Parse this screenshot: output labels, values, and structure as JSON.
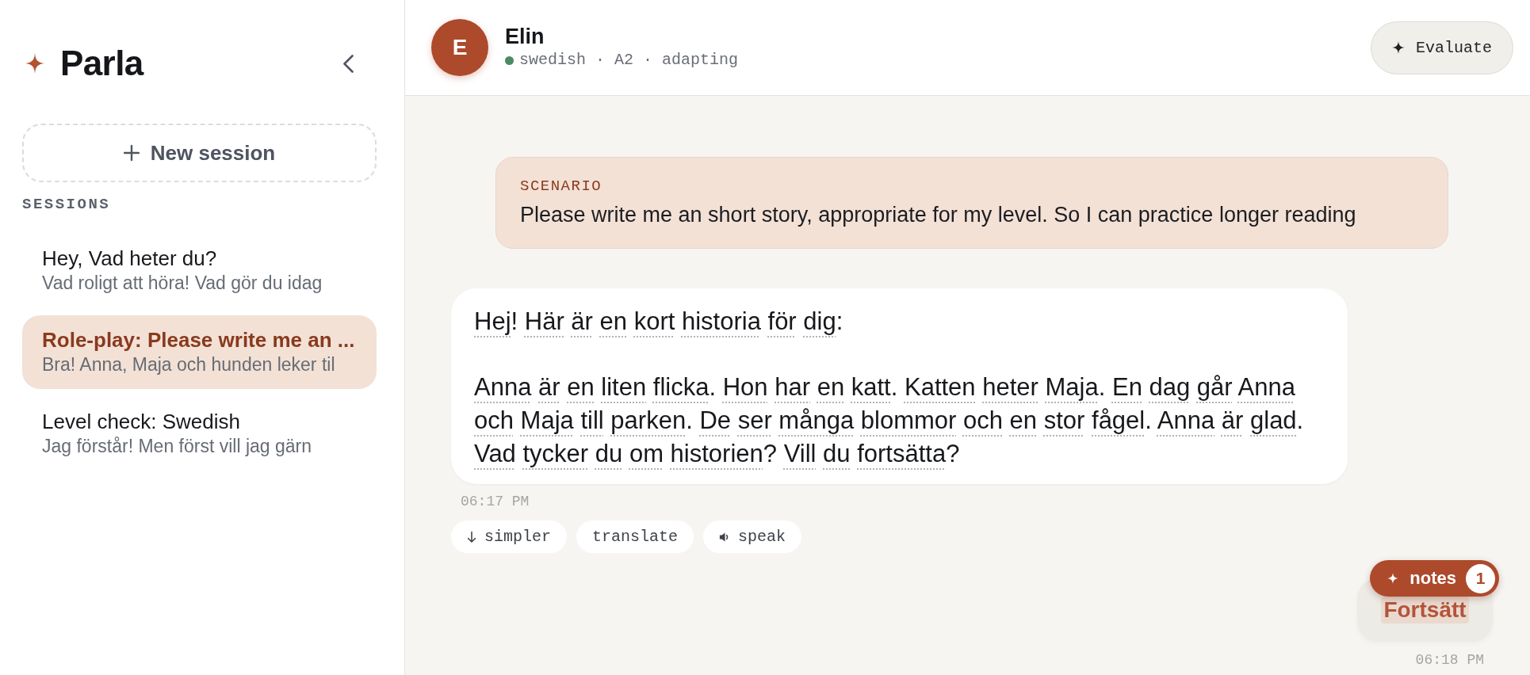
{
  "sidebar": {
    "brand": "Parla",
    "new_session_label": "New session",
    "sessions_heading": "SESSIONS",
    "sessions": [
      {
        "title": "Hey, Vad heter du?",
        "preview": "Vad roligt att höra! Vad gör du idag",
        "selected": false
      },
      {
        "title": "Role-play: Please write me an ...",
        "preview": "Bra! Anna, Maja och hunden leker til",
        "selected": true
      },
      {
        "title": "Level check: Swedish",
        "preview": "Jag förstår! Men först vill jag gärn",
        "selected": false
      }
    ]
  },
  "header": {
    "avatar_initial": "E",
    "name": "Elin",
    "online": true,
    "status": "swedish · A2 · adapting",
    "evaluate_label": "Evaluate"
  },
  "chat": {
    "scenario": {
      "label": "SCENARIO",
      "text": "Please write me an short story, appropriate for my level. So I can practice longer reading"
    },
    "messages": [
      {
        "kind": "assistant",
        "paragraphs": [
          "Hej! Här är en kort historia för dig:",
          "Anna är en liten flicka. Hon har en katt. Katten heter Maja. En dag går Anna och Maja till parken. De ser många blommor och en stor fågel. Anna är glad. Vad tycker du om historien? Vill du fortsätta?"
        ],
        "time": "06:17 PM",
        "actions": [
          {
            "kind": "simpler",
            "label": "simpler"
          },
          {
            "kind": "translate",
            "label": "translate"
          },
          {
            "kind": "speak",
            "label": "speak"
          }
        ]
      },
      {
        "kind": "user",
        "text": "Fortsätt",
        "time": "06:18 PM",
        "notes": {
          "label": "notes",
          "count": "1"
        }
      }
    ]
  }
}
